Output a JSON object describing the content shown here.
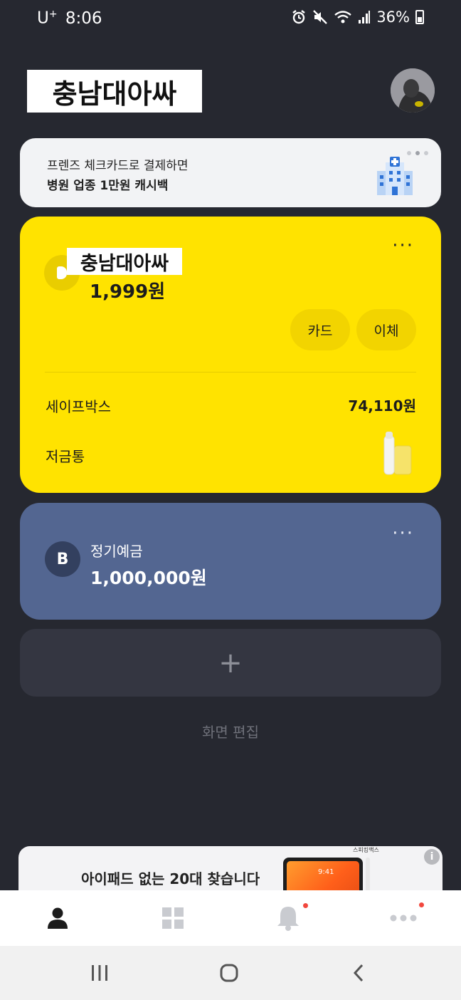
{
  "status_bar": {
    "carrier": "U",
    "carrier_sup": "+",
    "time": "8:06",
    "battery": "36%",
    "icons": [
      "alarm-icon",
      "mute-icon",
      "wifi-icon",
      "signal-icon",
      "battery-icon"
    ]
  },
  "header": {
    "user_name": "충남대아싸",
    "avatar_icon": "profile-avatar"
  },
  "banner": {
    "line1": "프렌즈 체크카드로 결제하면",
    "line2": "병원 업종 1만원 캐시백",
    "icon": "hospital-icon"
  },
  "main_account": {
    "name": "충남대아싸",
    "balance": "1,999원",
    "more": "···",
    "card_button": "카드",
    "transfer_button": "이체",
    "safebox_label": "세이프박스",
    "safebox_amount": "74,110원",
    "piggy_label": "저금통",
    "colors": {
      "card": "#ffe300"
    }
  },
  "deposit_account": {
    "logo": "B",
    "name": "정기예금",
    "balance": "1,000,000원",
    "more": "···",
    "colors": {
      "card": "#536691"
    }
  },
  "add_account": {
    "label": "+"
  },
  "edit_screen": "화면 편집",
  "ad": {
    "text": "아이패드 없는 20대 찾습니다",
    "brand": "스피킹맥스",
    "tablet_time": "9:41",
    "info": "i"
  },
  "bottom_nav": {
    "items": [
      {
        "icon": "person-icon",
        "active": true,
        "badge": false
      },
      {
        "icon": "grid-icon",
        "active": false,
        "badge": false
      },
      {
        "icon": "bell-icon",
        "active": false,
        "badge": true
      },
      {
        "icon": "more-icon",
        "active": false,
        "badge": true
      }
    ],
    "colors": {
      "active": "#1c1c1c",
      "inactive": "#c9cbd0",
      "badge": "#f2483e"
    }
  },
  "system_nav": {
    "buttons": [
      "recent-apps-icon",
      "home-icon",
      "back-icon"
    ]
  }
}
